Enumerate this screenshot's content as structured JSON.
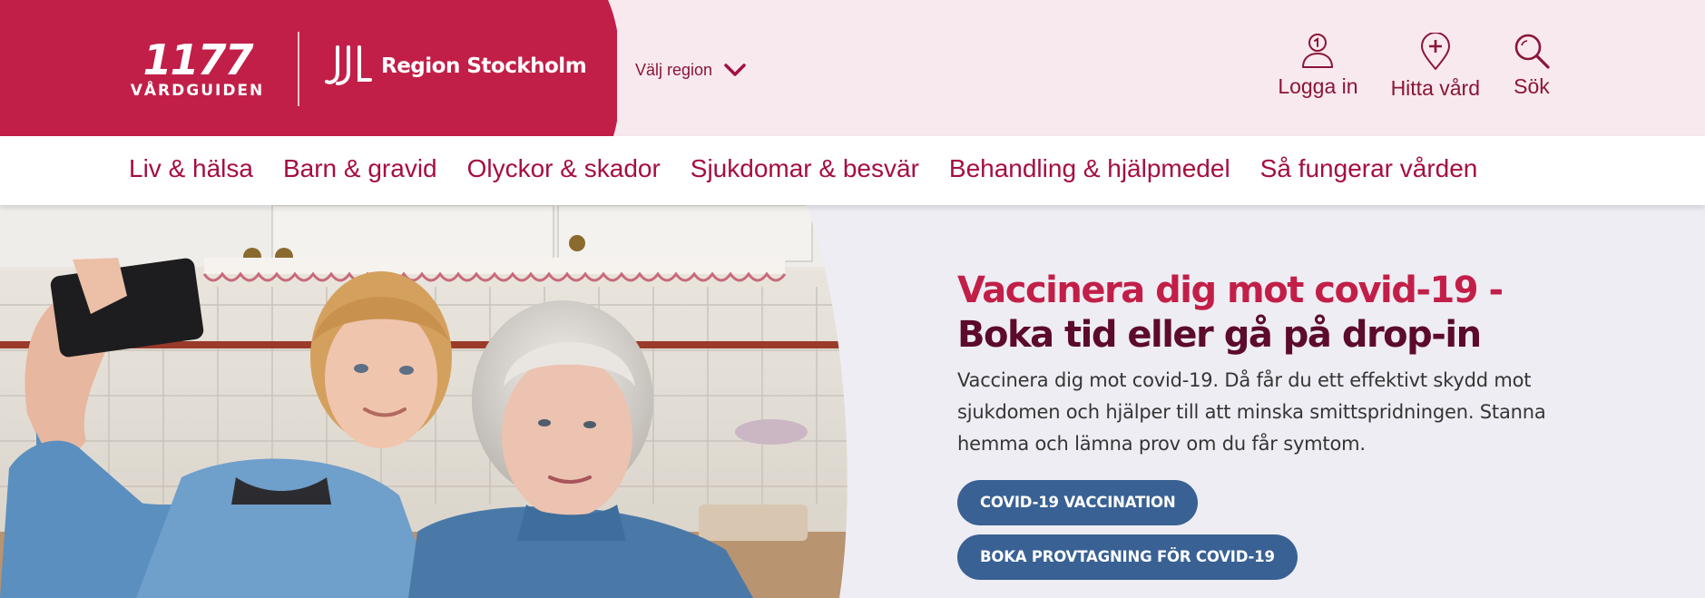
{
  "brand": {
    "logo_number": "1177",
    "logo_sub": "VÅRDGUIDEN",
    "region_name": "Region Stockholm",
    "primary_color": "#c21f48",
    "header_tint": "#f8e9ee"
  },
  "header": {
    "region_select_label": "Välj region",
    "actions": [
      {
        "label": "Logga in",
        "icon": "user-icon"
      },
      {
        "label": "Hitta vård",
        "icon": "location-cross-icon"
      },
      {
        "label": "Sök",
        "icon": "search-icon"
      }
    ]
  },
  "nav": {
    "items": [
      "Liv & hälsa",
      "Barn & gravid",
      "Olyckor & skador",
      "Sjukdomar & besvär",
      "Behandling & hjälpmedel",
      "Så fungerar vården"
    ]
  },
  "hero": {
    "title_part1": "Vaccinera dig mot covid-19 -",
    "title_part2": "Boka tid eller gå på drop-in",
    "text": "Vaccinera dig mot covid-19. Då får du ett effektivt skydd mot sjukdomen och hjälper till att minska smittspridningen. Stanna hemma och lämna prov om du får symtom.",
    "buttons": [
      "COVID-19 VACCINATION",
      "BOKA PROVTAGNING FÖR COVID-19"
    ],
    "button_color": "#396193",
    "photo": "two-women-taking-selfie-in-kitchen"
  }
}
